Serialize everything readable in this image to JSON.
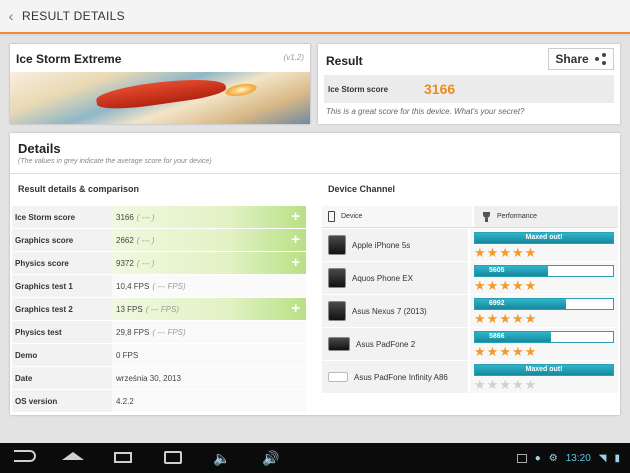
{
  "header": {
    "title": "RESULT DETAILS"
  },
  "test": {
    "name": "Ice Storm Extreme",
    "version": "(v1.2)"
  },
  "result": {
    "title": "Result",
    "share_label": "Share",
    "score_label": "Ice Storm score",
    "score_value": "3166",
    "message": "This is a great score for this device. What's your secret?"
  },
  "details": {
    "title": "Details",
    "subtitle": "(The values in grey indicate the average score for your device)",
    "left_title": "Result details & comparison",
    "right_title": "Device Channel",
    "rows": [
      {
        "label": "Ice Storm score",
        "value": "3166",
        "avg": "( --- )",
        "plus": "+"
      },
      {
        "label": "Graphics score",
        "value": "2662",
        "avg": "( --- )",
        "plus": "+"
      },
      {
        "label": "Physics score",
        "value": "9372",
        "avg": "( --- )",
        "plus": "+"
      },
      {
        "label": "Graphics test 1",
        "value": "10,4 FPS",
        "avg": "( --- FPS)",
        "plus": ""
      },
      {
        "label": "Graphics test 2",
        "value": "13 FPS",
        "avg": "( --- FPS)",
        "plus": "+"
      },
      {
        "label": "Physics test",
        "value": "29,8 FPS",
        "avg": "( --- FPS)",
        "plus": ""
      },
      {
        "label": "Demo",
        "value": "0 FPS",
        "avg": "",
        "plus": ""
      },
      {
        "label": "Date",
        "value": "września 30, 2013",
        "avg": "",
        "plus": ""
      },
      {
        "label": "OS version",
        "value": "4.2.2",
        "avg": "",
        "plus": ""
      }
    ]
  },
  "device_channel": {
    "col_device": "Device",
    "col_performance": "Performance",
    "devices": [
      {
        "name": "Apple iPhone 5s",
        "bar_text": "Maxed out!",
        "fill": 1.0,
        "stars": 5,
        "kind": "phone"
      },
      {
        "name": "Aquos Phone EX",
        "bar_text": "5605",
        "fill": 0.53,
        "stars": 5,
        "kind": "phone"
      },
      {
        "name": "Asus Nexus 7 (2013)",
        "bar_text": "6992",
        "fill": 0.66,
        "stars": 5,
        "kind": "phone"
      },
      {
        "name": "Asus PadFone 2",
        "bar_text": "5866",
        "fill": 0.55,
        "stars": 5,
        "kind": "tablet"
      },
      {
        "name": "Asus PadFone Infinity A86",
        "bar_text": "Maxed out!",
        "fill": 1.0,
        "stars": 0,
        "kind": "blank"
      }
    ]
  },
  "statusbar": {
    "time": "13:20"
  },
  "colors": {
    "accent": "#f08a22",
    "bar": "#1f9fb4",
    "highlight": "#b8e085"
  }
}
